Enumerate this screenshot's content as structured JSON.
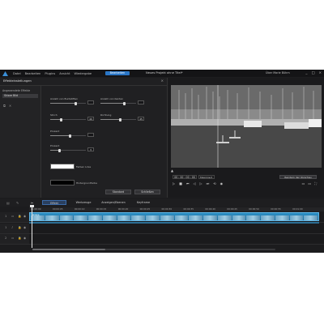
{
  "titlebar": {
    "menu": [
      "Datei",
      "Bearbeiten",
      "Plugins",
      "Ansicht",
      "Wiedergabe"
    ],
    "mode_button": "Bearbeiten",
    "project_title": "Neues Projekt ohne Titel*",
    "user": "Über Marie Bühm",
    "controls": [
      "_",
      "□",
      "×"
    ]
  },
  "dialog": {
    "title": "Effekteinstellungen",
    "close": "×",
    "left_label": "Angewendete Effekte",
    "effect_item": "Skizze Bild",
    "params": {
      "p1_label": "Anzahl von Buntstiften",
      "p2_label": "Anzahl von Kanten",
      "p3_label": "Strich",
      "p3_value": "40",
      "p4_label": "Richtung",
      "p4_value": "45",
      "p5_label": "Prozent",
      "p6_label": "Prozent",
      "p6_value": "3",
      "color1_label": "Farben Linie",
      "color2_label": "Hintergrundfarbe"
    },
    "sliders": {
      "p1_level": 0.72,
      "p2_level": 0.68,
      "p3_level": 0.3,
      "p4_level": 0.55,
      "p5_level": 0.55,
      "p6_level": 0.25
    },
    "buttons": {
      "reset": "Standard",
      "close": "Schließen"
    },
    "colors": {
      "line": "#ffffff",
      "background": "#000000"
    }
  },
  "preview": {
    "timecode": "00 : 00 : 00 : 00",
    "quality": "Maximiert",
    "render_button": "Rendern der Vorschau",
    "controls": [
      "▷",
      "■",
      "⏮",
      "◁",
      "▷",
      "⏭",
      "⟲",
      "◉"
    ],
    "right_controls": [
      "▭",
      "▭",
      "⛶"
    ]
  },
  "timeline": {
    "tabs": [
      "Effekt",
      "Werkzeuge",
      "Anzeigen/Ebenen",
      "Keyframe"
    ],
    "ruler_ticks": [
      "00:00:00",
      "00:00:05",
      "00:00:10",
      "00:00:15",
      "00:00:20",
      "00:00:25",
      "00:00:30",
      "00:00:35",
      "00:00:40",
      "00:00:45",
      "00:00:50",
      "00:00:55",
      "00:01:00"
    ],
    "tracks": [
      {
        "label": "1"
      },
      {
        "label": "1"
      },
      {
        "label": "2"
      }
    ],
    "clip_name": "Skizze"
  },
  "accent_color": "#2a76c6",
  "clip_color": "#2c8fc4"
}
